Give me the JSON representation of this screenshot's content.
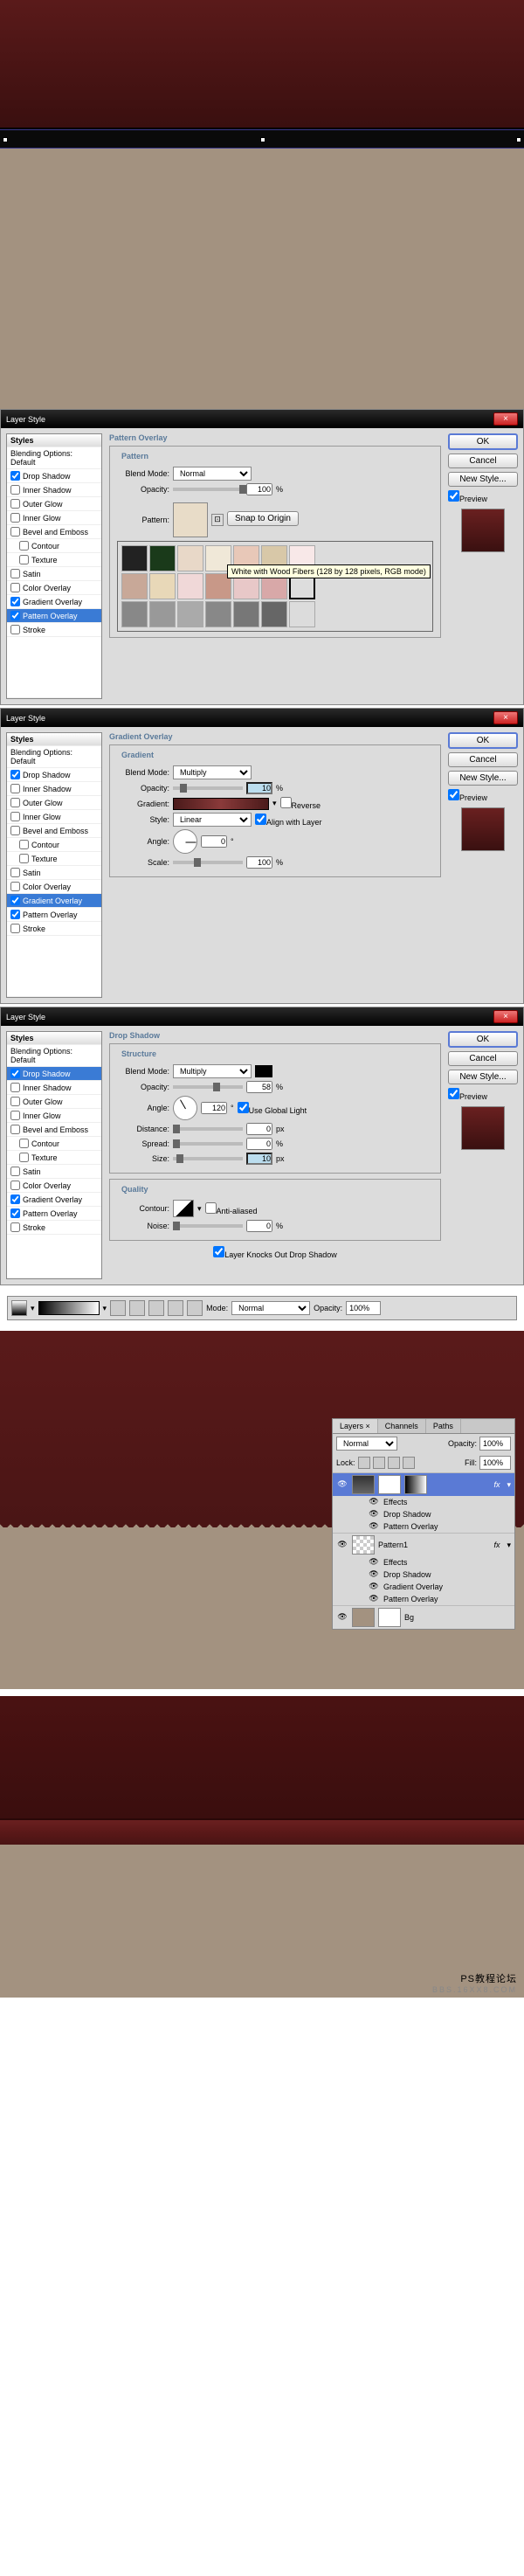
{
  "dialogs": {
    "title": "Layer Style",
    "close": "×",
    "styles_header": "Styles",
    "list": {
      "blending": "Blending Options: Default",
      "drop_shadow": "Drop Shadow",
      "inner_shadow": "Inner Shadow",
      "outer_glow": "Outer Glow",
      "inner_glow": "Inner Glow",
      "bevel": "Bevel and Emboss",
      "contour": "Contour",
      "texture": "Texture",
      "satin": "Satin",
      "color_overlay": "Color Overlay",
      "gradient_overlay": "Gradient Overlay",
      "pattern_overlay": "Pattern Overlay",
      "stroke": "Stroke"
    },
    "buttons": {
      "ok": "OK",
      "cancel": "Cancel",
      "new_style": "New Style...",
      "preview": "Preview"
    }
  },
  "pattern": {
    "title": "Pattern Overlay",
    "section": "Pattern",
    "blend_mode_lbl": "Blend Mode:",
    "blend_mode": "Normal",
    "opacity_lbl": "Opacity:",
    "opacity": "100",
    "pct": "%",
    "pattern_lbl": "Pattern:",
    "snap": "Snap to Origin",
    "tooltip": "White with Wood Fibers (128 by 128 pixels, RGB mode)"
  },
  "gradient": {
    "title": "Gradient Overlay",
    "section": "Gradient",
    "blend_mode_lbl": "Blend Mode:",
    "blend_mode": "Multiply",
    "opacity_lbl": "Opacity:",
    "opacity": "10",
    "pct": "%",
    "gradient_lbl": "Gradient:",
    "reverse": "Reverse",
    "style_lbl": "Style:",
    "style": "Linear",
    "align": "Align with Layer",
    "angle_lbl": "Angle:",
    "angle": "0",
    "deg": "°",
    "scale_lbl": "Scale:",
    "scale": "100"
  },
  "drop": {
    "title": "Drop Shadow",
    "section": "Structure",
    "blend_mode_lbl": "Blend Mode:",
    "blend_mode": "Multiply",
    "opacity_lbl": "Opacity:",
    "opacity": "58",
    "pct": "%",
    "angle_lbl": "Angle:",
    "angle": "120",
    "global": "Use Global Light",
    "distance_lbl": "Distance:",
    "distance": "0",
    "px": "px",
    "spread_lbl": "Spread:",
    "spread": "0",
    "size_lbl": "Size:",
    "size": "10",
    "quality": "Quality",
    "contour_lbl": "Contour:",
    "aa": "Anti-aliased",
    "noise_lbl": "Noise:",
    "noise": "0",
    "knockout": "Layer Knocks Out Drop Shadow"
  },
  "toolbar": {
    "mode_lbl": "Mode:",
    "mode": "Normal",
    "opacity_lbl": "Opacity:",
    "opacity": "100%"
  },
  "layers": {
    "tabs": {
      "layers": "Layers ×",
      "channels": "Channels",
      "paths": "Paths"
    },
    "blend": "Normal",
    "opacity_lbl": "Opacity:",
    "opacity": "100%",
    "lock_lbl": "Lock:",
    "fill_lbl": "Fill:",
    "fill": "100%",
    "fx": "fx",
    "effects": "Effects",
    "drop_shadow": "Drop Shadow",
    "gradient_overlay": "Gradient Overlay",
    "pattern_overlay": "Pattern Overlay",
    "layer_pattern": "Pattern1",
    "layer_bg": "Bg"
  },
  "footer": {
    "l1": "PS教程论坛",
    "l2": "BBS.16XX8.COM"
  }
}
